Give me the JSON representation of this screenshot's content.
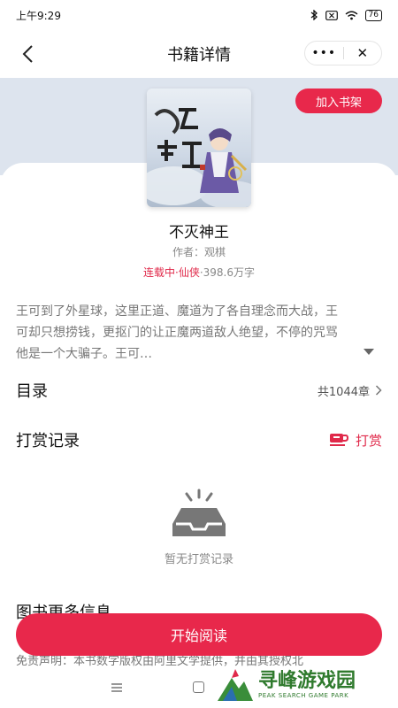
{
  "status_bar": {
    "time": "上午9:29",
    "battery": "76"
  },
  "nav": {
    "title": "书籍详情",
    "more": "•••",
    "close": "✕"
  },
  "book": {
    "shelf_button": "加入书架",
    "title": "不灭神王",
    "author": "作者：观棋",
    "status": "连载中",
    "dot1": "·",
    "genre": "仙侠",
    "dot2": "·",
    "word_count": "398.6万字",
    "intro": "王可到了外星球，这里正道、魔道为了各自理念而大战，王可却只想捞钱，更抠门的让正魔两道敌人绝望，不停的咒骂他是一个大骗子。王可…"
  },
  "catalog": {
    "label": "目录",
    "count": "共1044章"
  },
  "reward": {
    "label": "打赏记录",
    "button": "打赏",
    "empty": "暂无打赏记录"
  },
  "more_info": {
    "title": "图书更多信息",
    "disclaimer": "免责声明：本书数字版权由阿里文学提供，并由其授权北"
  },
  "start_button": "开始阅读",
  "watermark": {
    "cn": "寻峰游戏园",
    "en": "PEAK SEARCH GAME PARK"
  }
}
